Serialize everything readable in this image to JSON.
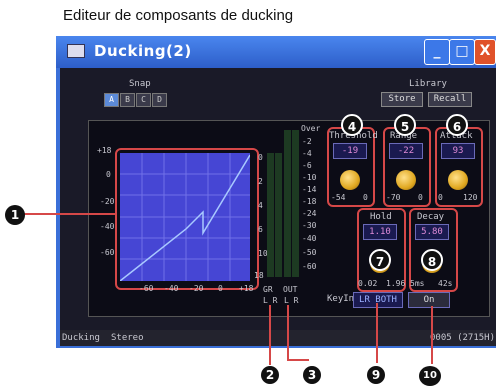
{
  "caption": "Editeur de composants de ducking",
  "window": {
    "title": "Ducking(2)",
    "minimize": "_",
    "maximize": "□",
    "close": "X"
  },
  "snap": {
    "label": "Snap",
    "buttons": [
      "A",
      "B",
      "C",
      "D"
    ],
    "selected": "A"
  },
  "library": {
    "label": "Library",
    "store": "Store",
    "recall": "Recall"
  },
  "graph": {
    "y_ticks": [
      "+18",
      "0",
      "-20",
      "-40",
      "-60"
    ],
    "x_ticks": [
      "-60",
      "-40",
      "-20",
      "0",
      "+18"
    ]
  },
  "meter": {
    "over": "Over",
    "scale": [
      "-2",
      "-4",
      "-6",
      "-10",
      "-14",
      "-18",
      "-24",
      "-30",
      "-40",
      "-50",
      "-60"
    ],
    "left_scale": [
      "0",
      "2",
      "4",
      "6",
      "10",
      "18"
    ],
    "gr_label": "GR",
    "out_label": "OUT",
    "gr_lr": "L R",
    "out_lr": "L R"
  },
  "params": {
    "threshold": {
      "label": "Threshold",
      "value": "-19",
      "min": "-54",
      "max": "0"
    },
    "range": {
      "label": "Range",
      "value": "-22",
      "min": "-70",
      "max": "0"
    },
    "attack": {
      "label": "Attack",
      "value": "93",
      "min": "0",
      "max": "120"
    },
    "hold": {
      "label": "Hold",
      "value": "1.10",
      "min": "0.02",
      "max": "1.96"
    },
    "decay": {
      "label": "Decay",
      "value": "5.80",
      "min": "5ms",
      "max": "42s"
    }
  },
  "keyin": {
    "label": "KeyIn",
    "value": "LR BOTH"
  },
  "on_button": "On",
  "status": {
    "left1": "Ducking",
    "left2": "Stereo",
    "right": "0005 (2715H)"
  },
  "callouts": [
    "1",
    "2",
    "3",
    "4",
    "5",
    "6",
    "7",
    "8",
    "9",
    "10"
  ]
}
